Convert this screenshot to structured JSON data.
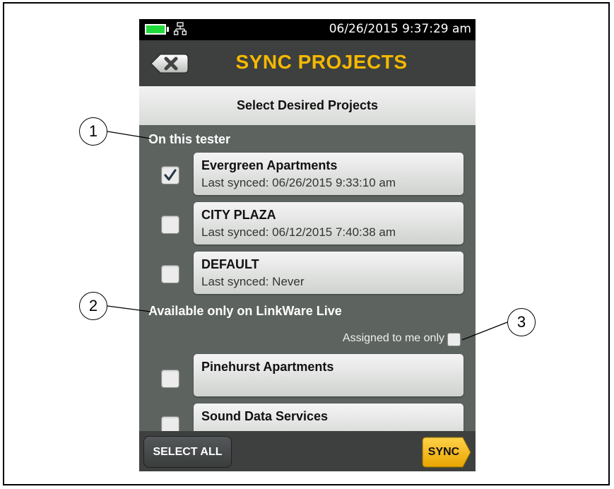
{
  "status_bar": {
    "datetime": "06/26/2015 9:37:29 am",
    "battery_icon": "battery-icon",
    "network_icon": "network-icon"
  },
  "header": {
    "title": "SYNC PROJECTS",
    "back_icon": "close-x-icon"
  },
  "subheader": {
    "title": "Select Desired Projects"
  },
  "sections": {
    "on_tester_label": "On this tester",
    "linkware_label": "Available only on LinkWare Live",
    "assigned_filter_label": "Assigned to me only"
  },
  "tester_projects": [
    {
      "name": "Evergreen Apartments",
      "last_synced": "Last synced: 06/26/2015 9:33:10 am",
      "checked": true
    },
    {
      "name": "CITY PLAZA",
      "last_synced": "Last synced: 06/12/2015 7:40:38 am",
      "checked": false
    },
    {
      "name": "DEFAULT",
      "last_synced": "Last synced: Never",
      "checked": false
    }
  ],
  "linkware_projects": [
    {
      "name": "Pinehurst Apartments",
      "checked": false
    },
    {
      "name": "Sound Data Services",
      "checked": false
    }
  ],
  "footer": {
    "select_all_label": "SELECT ALL",
    "sync_label": "SYNC"
  },
  "callouts": [
    "1",
    "2",
    "3"
  ],
  "colors": {
    "accent_yellow": "#f5b800",
    "background": "#5d6460",
    "bar": "#3d403e",
    "battery_green": "#1fdc3b"
  }
}
